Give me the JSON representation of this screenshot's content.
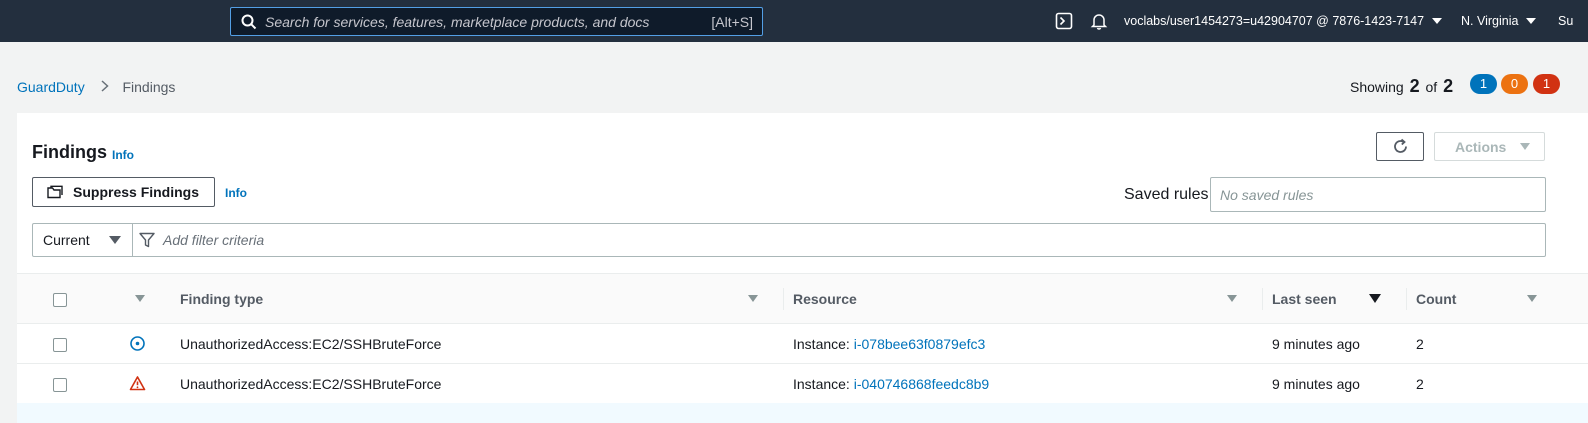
{
  "topnav": {
    "search_placeholder": "Search for services, features, marketplace products, and docs",
    "search_shortcut": "[Alt+S]",
    "account": "voclabs/user1454273=u42904707 @ 7876-1423-7147",
    "region": "N. Virginia",
    "support": "Su",
    "icons": [
      "search-icon",
      "cloudshell-icon",
      "bell-icon"
    ]
  },
  "breadcrumb": {
    "root": "GuardDuty",
    "current": "Findings"
  },
  "summary": {
    "showing_label": "Showing",
    "shown": "2",
    "of_label": "of",
    "total": "2",
    "badges": [
      {
        "value": "1",
        "color": "#0073bb"
      },
      {
        "value": "0",
        "color": "#ec7211"
      },
      {
        "value": "1",
        "color": "#d13212"
      }
    ]
  },
  "panel": {
    "title": "Findings",
    "info": "Info",
    "suppress_label": "Suppress Findings",
    "suppress_info": "Info",
    "actions_label": "Actions",
    "saved_rules_label": "Saved rules",
    "saved_rules_placeholder": "No saved rules",
    "filter_select": "Current",
    "filter_placeholder": "Add filter criteria"
  },
  "table": {
    "columns": [
      "Finding type",
      "Resource",
      "Last seen",
      "Count"
    ],
    "rows": [
      {
        "severity": "low",
        "severity_icon": "info-circle-icon",
        "finding_type": "UnauthorizedAccess:EC2/SSHBruteForce",
        "resource_prefix": "Instance:",
        "resource_id": "i-078bee63f0879efc3",
        "last_seen": "9 minutes ago",
        "count": "2"
      },
      {
        "severity": "high",
        "severity_icon": "warning-triangle-icon",
        "finding_type": "UnauthorizedAccess:EC2/SSHBruteForce",
        "resource_prefix": "Instance:",
        "resource_id": "i-040746868feedc8b9",
        "last_seen": "9 minutes ago",
        "count": "2"
      }
    ]
  },
  "colors": {
    "nav_bg": "#232f3e",
    "link": "#0073bb",
    "low": "#0073bb",
    "high": "#d13212"
  }
}
